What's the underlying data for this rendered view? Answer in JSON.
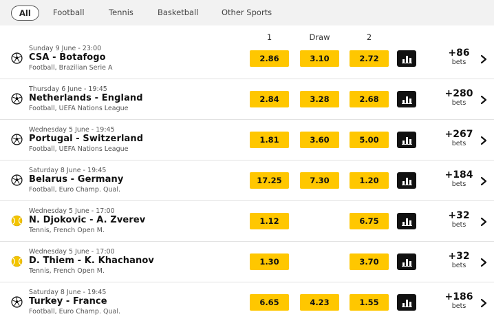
{
  "tabs": [
    {
      "label": "All",
      "active": true
    },
    {
      "label": "Football"
    },
    {
      "label": "Tennis"
    },
    {
      "label": "Basketball"
    },
    {
      "label": "Other Sports"
    }
  ],
  "columns": {
    "home": "1",
    "draw": "Draw",
    "away": "2"
  },
  "events": [
    {
      "sport_icon": "football-icon",
      "date": "Sunday 9 June - 23:00",
      "teams": "CSA - Botafogo",
      "league": "Football, Brazilian Serie A",
      "odds": {
        "home": "2.86",
        "draw": "3.10",
        "away": "2.72"
      },
      "more_count": "+86",
      "more_label": "bets"
    },
    {
      "sport_icon": "football-icon",
      "date": "Thursday 6 June - 19:45",
      "teams": "Netherlands - England",
      "league": "Football, UEFA Nations League",
      "odds": {
        "home": "2.84",
        "draw": "3.28",
        "away": "2.68"
      },
      "more_count": "+280",
      "more_label": "bets"
    },
    {
      "sport_icon": "football-icon",
      "date": "Wednesday 5 June - 19:45",
      "teams": "Portugal - Switzerland",
      "league": "Football, UEFA Nations League",
      "odds": {
        "home": "1.81",
        "draw": "3.60",
        "away": "5.00"
      },
      "more_count": "+267",
      "more_label": "bets"
    },
    {
      "sport_icon": "football-icon",
      "date": "Saturday 8 June - 19:45",
      "teams": "Belarus - Germany",
      "league": "Football, Euro Champ. Qual.",
      "odds": {
        "home": "17.25",
        "draw": "7.30",
        "away": "1.20"
      },
      "more_count": "+184",
      "more_label": "bets"
    },
    {
      "sport_icon": "tennis-ball-icon",
      "date": "Wednesday 5 June - 17:00",
      "teams": "N. Djokovic - A. Zverev",
      "league": "Tennis, French Open M.",
      "odds": {
        "home": "1.12",
        "away": "6.75"
      },
      "more_count": "+32",
      "more_label": "bets"
    },
    {
      "sport_icon": "tennis-ball-icon",
      "date": "Wednesday 5 June - 17:00",
      "teams": "D. Thiem - K. Khachanov",
      "league": "Tennis, French Open M.",
      "odds": {
        "home": "1.30",
        "away": "3.70"
      },
      "more_count": "+32",
      "more_label": "bets"
    },
    {
      "sport_icon": "football-icon",
      "date": "Saturday 8 June - 19:45",
      "teams": "Turkey - France",
      "league": "Football, Euro Champ. Qual.",
      "odds": {
        "home": "6.65",
        "draw": "4.23",
        "away": "1.55"
      },
      "more_count": "+186",
      "more_label": "bets"
    }
  ],
  "colors": {
    "odds_button": "#ffc700",
    "stats_button": "#111111",
    "tab_bar": "#f2f2f2"
  }
}
